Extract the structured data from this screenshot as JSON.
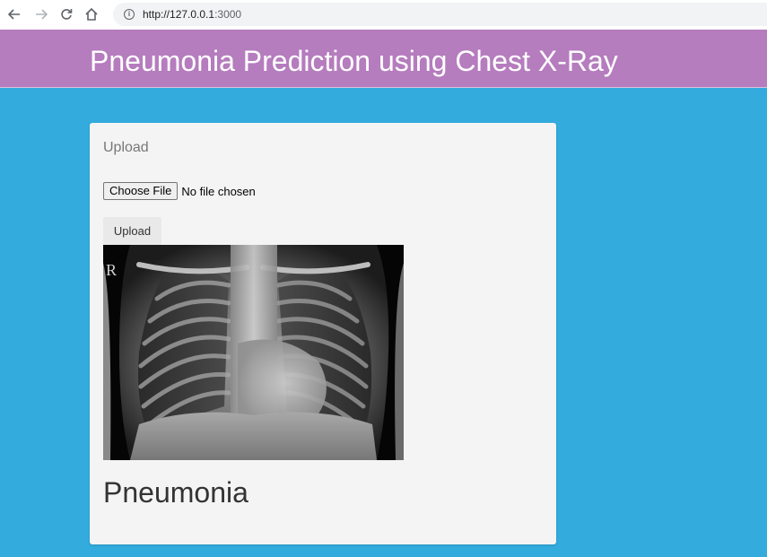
{
  "browser": {
    "url_host": "http://127.0.0.1",
    "url_port": ":3000"
  },
  "header": {
    "title": "Pneumonia Prediction using Chest X-Ray"
  },
  "card": {
    "label": "Upload",
    "file_button": "Choose File",
    "file_status": "No file chosen",
    "upload_button": "Upload",
    "image_marker": "R",
    "prediction": "Pneumonia"
  },
  "colors": {
    "page_background": "#33abdd",
    "header_background": "#b57cbe",
    "card_background": "#f4f4f4"
  }
}
